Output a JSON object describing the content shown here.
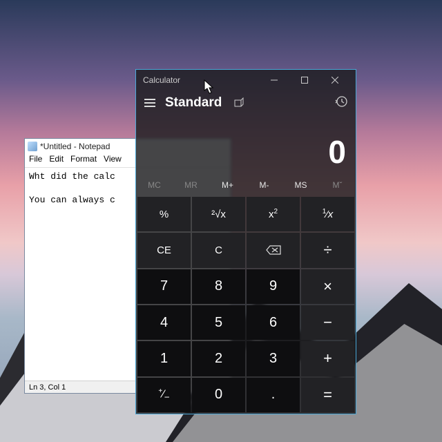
{
  "notepad": {
    "title": "*Untitled - Notepad",
    "menu": [
      "File",
      "Edit",
      "Format",
      "View"
    ],
    "body": "Wht did the calc\n\nYou can always c",
    "status": "Ln 3, Col 1"
  },
  "calculator": {
    "title": "Calculator",
    "mode": "Standard",
    "display": "0",
    "memory": {
      "mc": "MC",
      "mr": "MR",
      "mplus": "M+",
      "mminus": "M-",
      "ms": "MS",
      "mlist": "Mˇ"
    },
    "keys": {
      "percent": "%",
      "sqrt": "²√x",
      "square": "x²",
      "recip": "¹⁄x",
      "ce": "CE",
      "c": "C",
      "back": "⌫",
      "div": "÷",
      "n7": "7",
      "n8": "8",
      "n9": "9",
      "mul": "×",
      "n4": "4",
      "n5": "5",
      "n6": "6",
      "sub": "−",
      "n1": "1",
      "n2": "2",
      "n3": "3",
      "add": "+",
      "neg": "⁺⁄₋",
      "n0": "0",
      "dot": ".",
      "eq": "="
    }
  }
}
